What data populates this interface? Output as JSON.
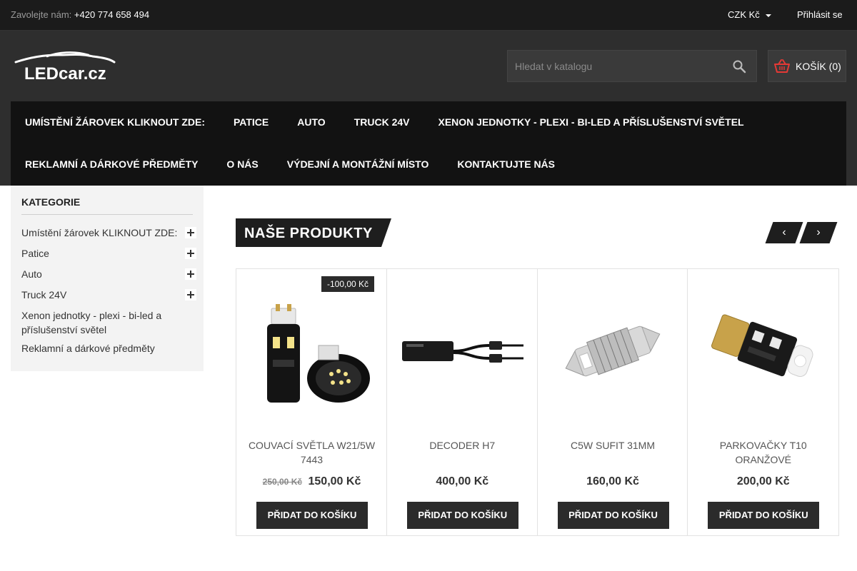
{
  "topbar": {
    "contact_label": "Zavolejte nám:",
    "phone": "+420 774 658 494",
    "currency": "CZK Kč",
    "login": "Přihlásit se"
  },
  "header": {
    "logo_text": "LEDcar.cz",
    "search_placeholder": "Hledat v katalogu",
    "cart_label": "KOŠÍK (0)"
  },
  "nav": {
    "row1": [
      "UMÍSTĚNÍ ŽÁROVEK KLIKNOUT ZDE:",
      "PATICE",
      "AUTO",
      "TRUCK 24V",
      "XENON JEDNOTKY - PLEXI - BI-LED A PŘÍSLUŠENSTVÍ SVĚTEL"
    ],
    "row2": [
      "REKLAMNÍ A DÁRKOVÉ PŘEDMĚTY",
      "O NÁS",
      "VÝDEJNÍ A MONTÁŽNÍ MÍSTO",
      "KONTAKTUJTE NÁS"
    ]
  },
  "sidebar": {
    "title": "KATEGORIE",
    "items": [
      {
        "label": "Umístění žárovek KLIKNOUT ZDE:",
        "expandable": true
      },
      {
        "label": "Patice",
        "expandable": true
      },
      {
        "label": "Auto",
        "expandable": true
      },
      {
        "label": "Truck 24V",
        "expandable": true
      },
      {
        "label": "Xenon jednotky - plexi - bi-led a příslušenství světel",
        "expandable": false
      },
      {
        "label": "Reklamní a dárkové předměty",
        "expandable": false
      }
    ]
  },
  "section": {
    "title": "NAŠE PRODUKTY",
    "prev": "‹",
    "next": "›"
  },
  "products": [
    {
      "name": "COUVACÍ SVĚTLA W21/5W 7443",
      "badge": "-100,00 Kč",
      "old_price": "250,00 Kč",
      "price": "150,00 Kč",
      "button": "PŘIDAT DO KOŠÍKU"
    },
    {
      "name": "DECODER H7",
      "badge": "",
      "old_price": "",
      "price": "400,00 Kč",
      "button": "PŘIDAT DO KOŠÍKU"
    },
    {
      "name": "C5W SUFIT 31MM",
      "badge": "",
      "old_price": "",
      "price": "160,00 Kč",
      "button": "PŘIDAT DO KOŠÍKU"
    },
    {
      "name": "PARKOVAČKY T10 ORANŽOVÉ",
      "badge": "",
      "old_price": "",
      "price": "200,00 Kč",
      "button": "PŘIDAT DO KOŠÍKU"
    }
  ],
  "colors": {
    "topbar_bg": "#1b1b1b",
    "header_bg": "#2e2e2e",
    "nav_bg": "#121212",
    "cart_icon": "#e53935",
    "button_bg": "#2b2b2b"
  }
}
